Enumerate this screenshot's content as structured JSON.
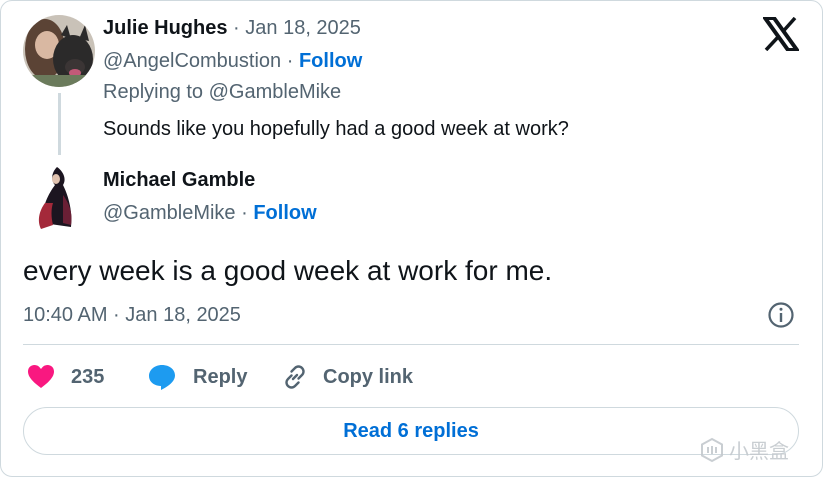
{
  "parent_tweet": {
    "author_name": "Julie Hughes",
    "separator": " · ",
    "date": "Jan 18, 2025",
    "handle": "@AngelCombustion",
    "handle_separator": " · ",
    "follow_label": "Follow",
    "replying_to": "Replying to @GambleMike",
    "text": "Sounds like you hopefully had a good week at work?"
  },
  "main_tweet": {
    "author_name": "Michael Gamble",
    "handle": "@GambleMike",
    "handle_separator": " · ",
    "follow_label": "Follow",
    "text": "every week is a good week at work for me.",
    "timestamp": "10:40 AM · Jan 18, 2025"
  },
  "actions": {
    "like_count": "235",
    "reply_label": "Reply",
    "copy_link_label": "Copy link"
  },
  "read_replies_label": "Read 6 replies",
  "watermark": {
    "text": "小黑盒"
  },
  "colors": {
    "like": "#f91880",
    "reply_icon": "#1d9bf0",
    "link": "#006fd6",
    "muted": "#536471",
    "border": "#cfd9de"
  },
  "icons": [
    "x-logo-icon",
    "heart-icon",
    "reply-bubble-icon",
    "link-icon",
    "info-icon",
    "watermark-icon"
  ]
}
